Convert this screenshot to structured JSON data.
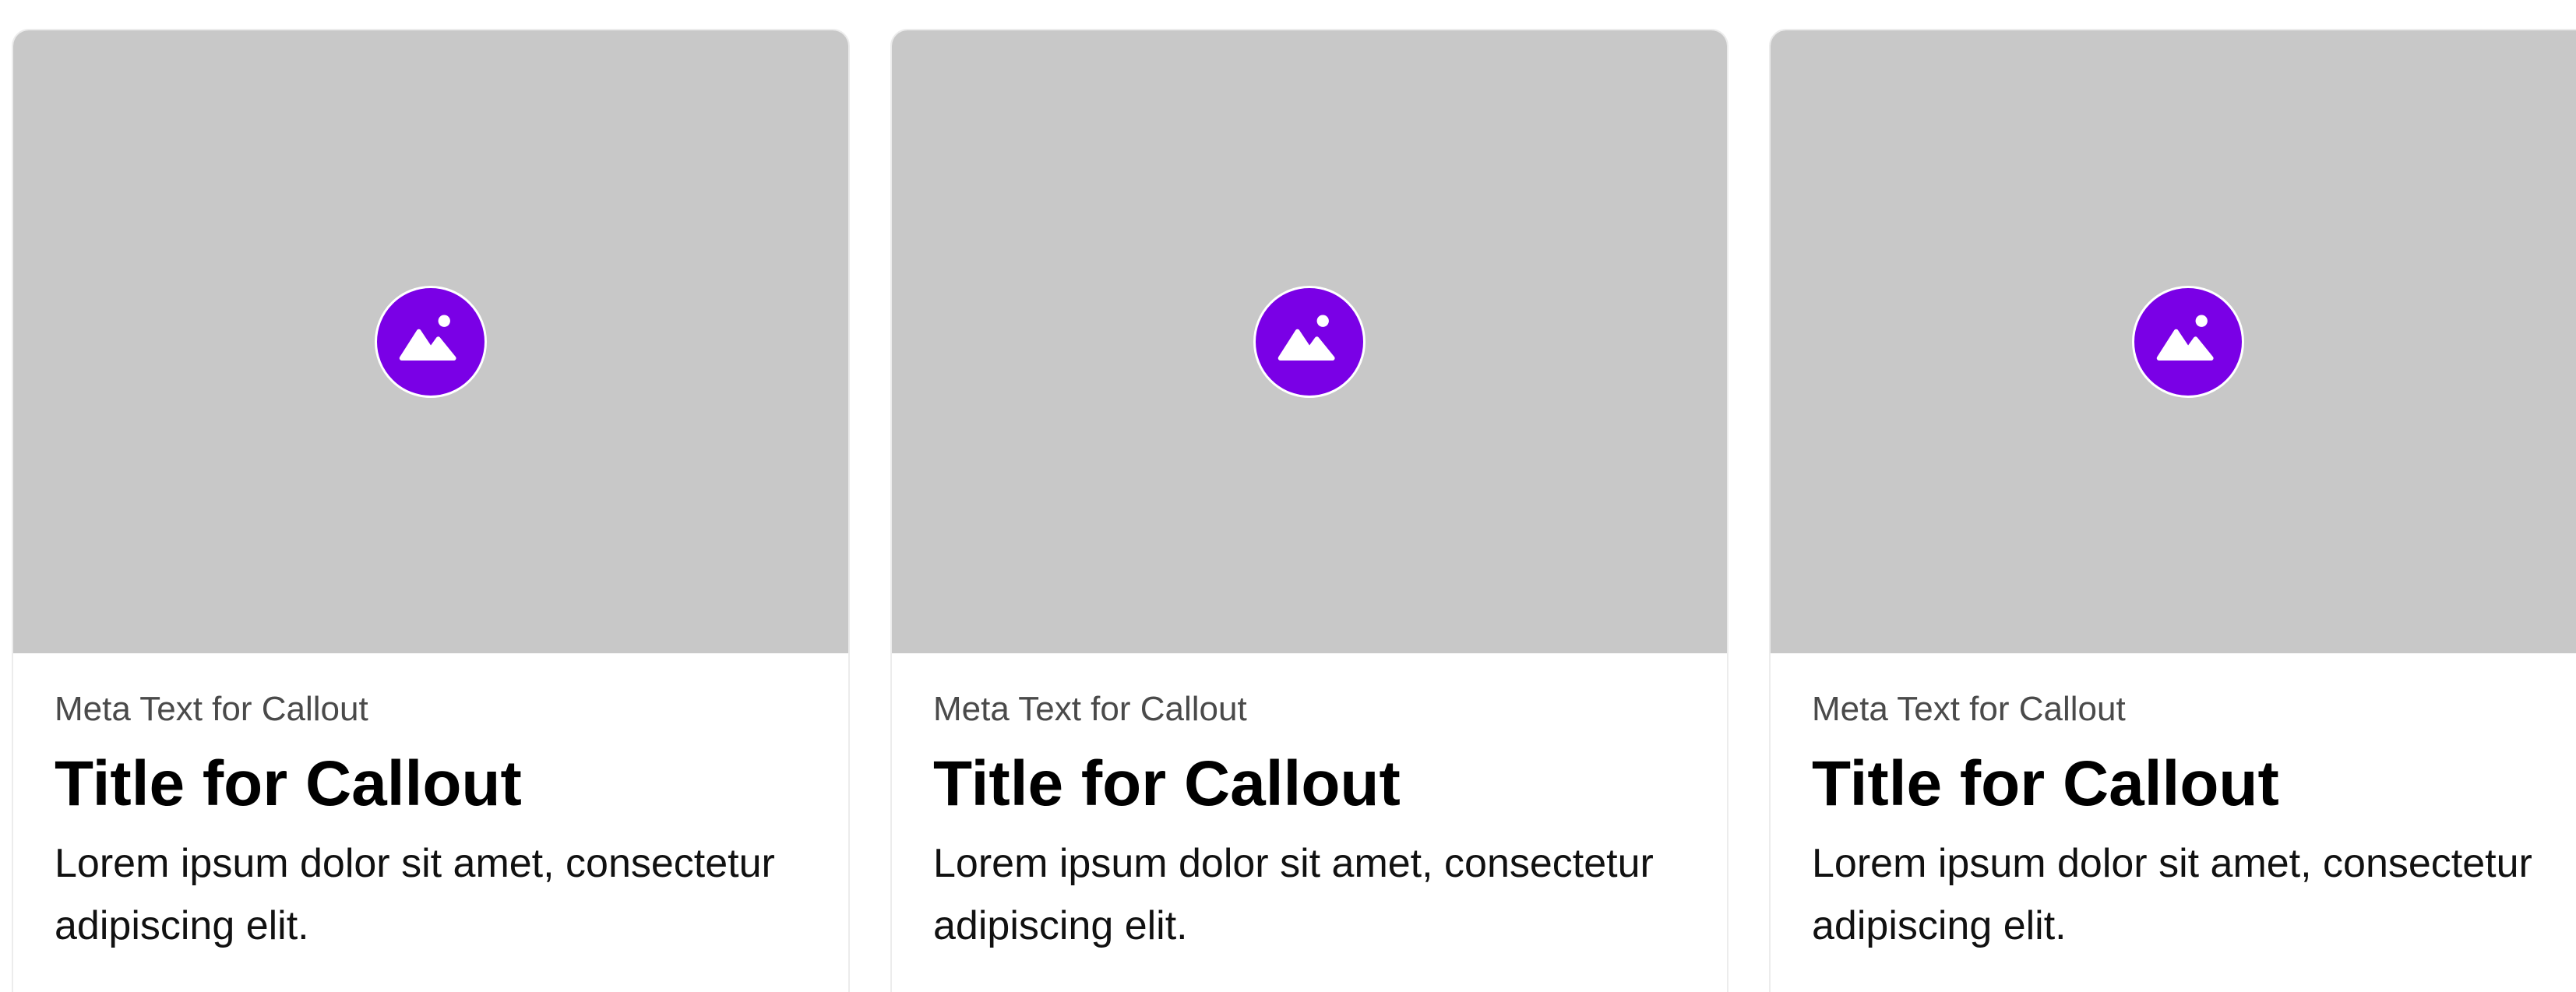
{
  "colors": {
    "placeholder_bg": "#c8c8c8",
    "icon_bg": "#7a00e6",
    "icon_fg": "#ffffff",
    "meta_text": "#4a4a4a",
    "title_text": "#000000"
  },
  "cards": [
    {
      "icon": "image-icon",
      "meta": "Meta Text for Callout",
      "title": "Title for Callout",
      "description": "Lorem ipsum dolor sit amet, consectetur adipiscing elit."
    },
    {
      "icon": "image-icon",
      "meta": "Meta Text for Callout",
      "title": "Title for Callout",
      "description": "Lorem ipsum dolor sit amet, consectetur adipiscing elit."
    },
    {
      "icon": "image-icon",
      "meta": "Meta Text for Callout",
      "title": "Title for Callout",
      "description": "Lorem ipsum dolor sit amet, consectetur adipiscing elit."
    }
  ]
}
